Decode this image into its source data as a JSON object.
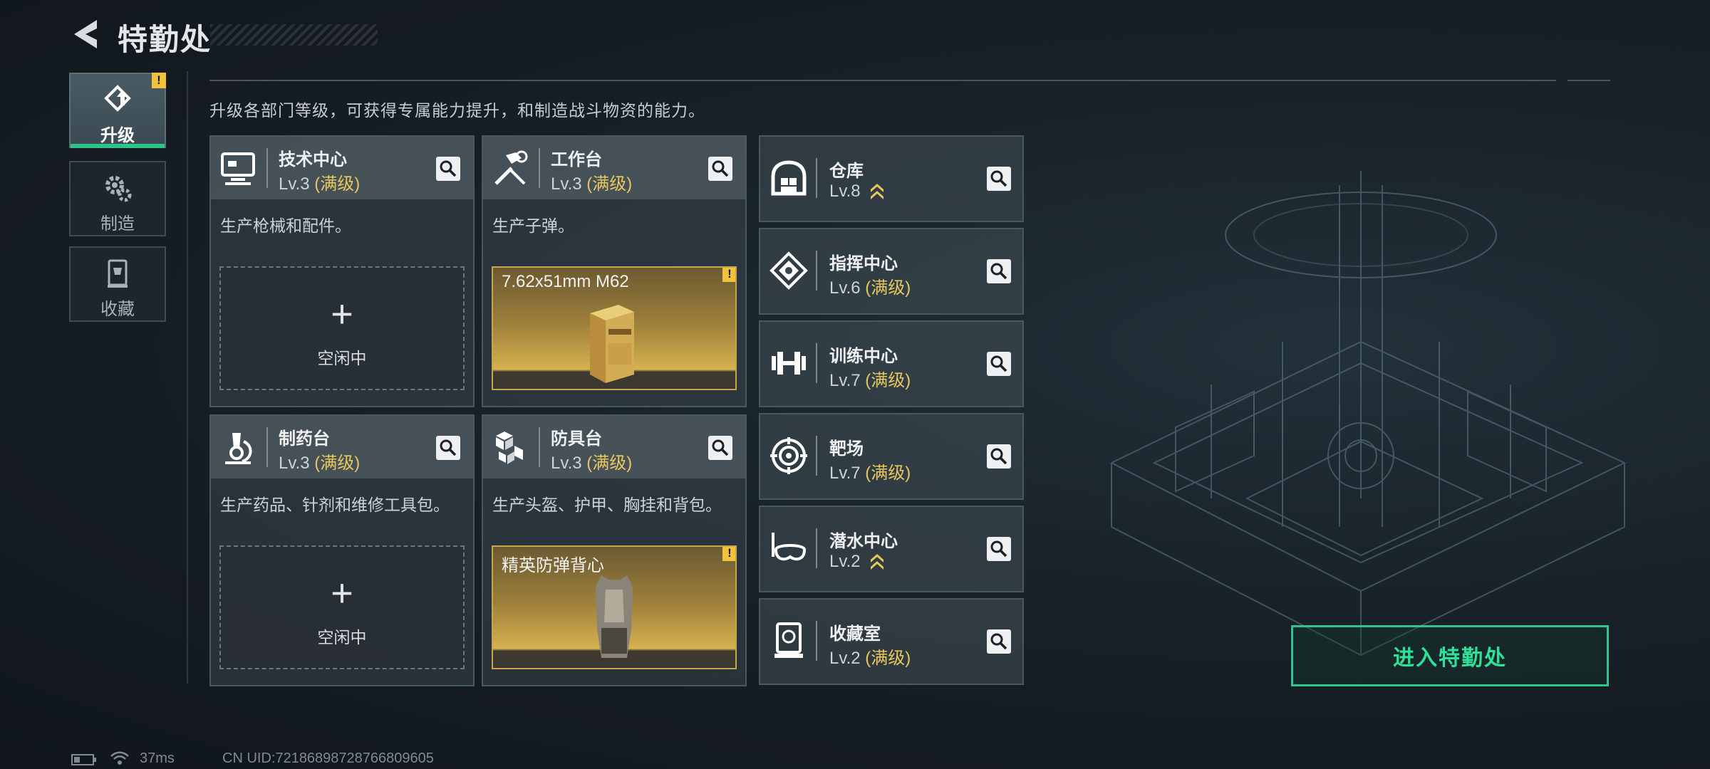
{
  "header": {
    "title": "特勤处"
  },
  "nav": [
    {
      "label": "升级",
      "icon": "upgrade-icon",
      "active": true
    },
    {
      "label": "制造",
      "icon": "gears-icon",
      "active": false
    },
    {
      "label": "收藏",
      "icon": "trophy-case-icon",
      "active": false
    }
  ],
  "description": "升级各部门等级，可获得专属能力提升，和制造战斗物资的能力。",
  "cards": [
    {
      "name": "技术中心",
      "level": "Lv.3",
      "max": "(满级)",
      "desc": "生产枪械和配件。",
      "status": "空闲中",
      "icon": "computer-icon"
    },
    {
      "name": "工作台",
      "level": "Lv.3",
      "max": "(满级)",
      "desc": "生产子弹。",
      "product": "7.62x51mm M62",
      "icon": "tools-icon"
    },
    {
      "name": "制药台",
      "level": "Lv.3",
      "max": "(满级)",
      "desc": "生产药品、针剂和维修工具包。",
      "status": "空闲中",
      "icon": "microscope-icon"
    },
    {
      "name": "防具台",
      "level": "Lv.3",
      "max": "(满级)",
      "desc": "生产头盔、护甲、胸挂和背包。",
      "product": "精英防弹背心",
      "icon": "cubes-icon"
    }
  ],
  "side_facilities": [
    {
      "name": "仓库",
      "level": "Lv.8",
      "max": "",
      "upgradable": true,
      "icon": "warehouse-icon"
    },
    {
      "name": "指挥中心",
      "level": "Lv.6",
      "max": "(满级)",
      "upgradable": false,
      "icon": "command-icon"
    },
    {
      "name": "训练中心",
      "level": "Lv.7",
      "max": "(满级)",
      "upgradable": false,
      "icon": "dumbbell-icon"
    },
    {
      "name": "靶场",
      "level": "Lv.7",
      "max": "(满级)",
      "upgradable": false,
      "icon": "target-icon"
    },
    {
      "name": "潜水中心",
      "level": "Lv.2",
      "max": "",
      "upgradable": true,
      "icon": "diving-mask-icon"
    },
    {
      "name": "收藏室",
      "level": "Lv.2",
      "max": "(满级)",
      "upgradable": false,
      "icon": "display-case-icon"
    }
  ],
  "enter_button": "进入特勤处",
  "status_bar": {
    "ping": "37ms",
    "uid": "CN UID:72186898728766809605"
  },
  "colors": {
    "accent": "#2fc58a",
    "max_level": "#e8c75d",
    "warning": "#f3c23c"
  }
}
